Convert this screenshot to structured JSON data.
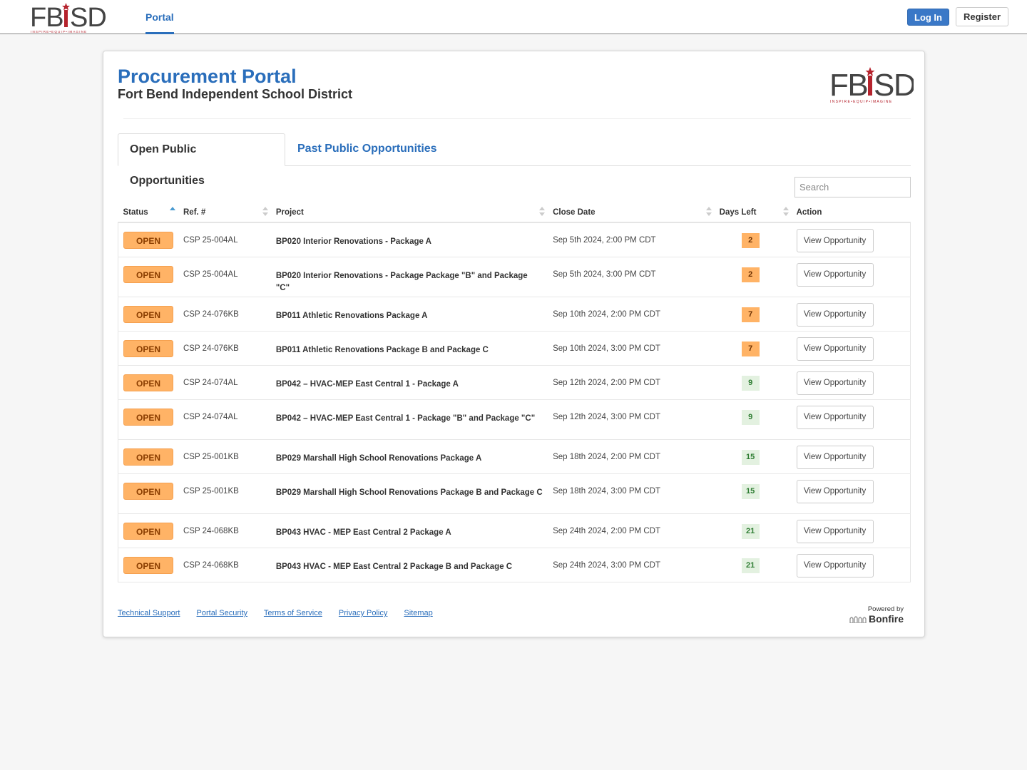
{
  "navbar": {
    "logo_text": "FBISD",
    "logo_tagline": "INSPIRE • EQUIP • IMAGINE",
    "nav_link": "Portal",
    "login_label": "Log In",
    "register_label": "Register",
    "accent_color": "#2a6ebb",
    "logo_accent_color": "#b5232d"
  },
  "header": {
    "title": "Procurement Portal",
    "subtitle": "Fort Bend Independent School District",
    "logo_text": "FBISD",
    "logo_tagline": "INSPIRE • EQUIP • IMAGINE"
  },
  "tabs": [
    {
      "label": "Open Public Opportunities",
      "active": true
    },
    {
      "label": "Past Public Opportunities",
      "active": false
    }
  ],
  "search": {
    "placeholder": "Search",
    "value": ""
  },
  "table": {
    "columns": [
      {
        "label": "Status",
        "sort": "asc"
      },
      {
        "label": "Ref. #",
        "sort": "none"
      },
      {
        "label": "Project",
        "sort": "none"
      },
      {
        "label": "Close Date",
        "sort": "none"
      },
      {
        "label": "Days Left",
        "sort": "none"
      },
      {
        "label": "Action",
        "sort": null
      }
    ],
    "rows": [
      {
        "status": "OPEN",
        "ref": "CSP 25-004AL",
        "project": "BP020 Interior Renovations - Package A",
        "close_date": "Sep 5th 2024, 2:00 PM CDT",
        "days_left": "2",
        "days_level": "warn",
        "action": "View Opportunity"
      },
      {
        "status": "OPEN",
        "ref": "CSP 25-004AL",
        "project": "BP020 Interior Renovations - Package Package \"B\" and Package \"C\"",
        "close_date": "Sep 5th 2024, 3:00 PM CDT",
        "days_left": "2",
        "days_level": "warn",
        "action": "View Opportunity"
      },
      {
        "status": "OPEN",
        "ref": "CSP 24-076KB",
        "project": "BP011 Athletic Renovations Package A",
        "close_date": "Sep 10th 2024, 2:00 PM CDT",
        "days_left": "7",
        "days_level": "warn",
        "action": "View Opportunity"
      },
      {
        "status": "OPEN",
        "ref": "CSP 24-076KB",
        "project": "BP011 Athletic Renovations Package B and Package C",
        "close_date": "Sep 10th 2024, 3:00 PM CDT",
        "days_left": "7",
        "days_level": "warn",
        "action": "View Opportunity"
      },
      {
        "status": "OPEN",
        "ref": "CSP 24-074AL",
        "project": "BP042 – HVAC-MEP East Central 1 - Package A",
        "close_date": "Sep 12th 2024, 2:00 PM CDT",
        "days_left": "9",
        "days_level": "ok",
        "action": "View Opportunity"
      },
      {
        "status": "OPEN",
        "ref": "CSP 24-074AL",
        "project": "BP042 – HVAC-MEP East Central 1 - Package \"B\" and Package \"C\"",
        "close_date": "Sep 12th 2024, 3:00 PM CDT",
        "days_left": "9",
        "days_level": "ok",
        "action": "View Opportunity"
      },
      {
        "status": "OPEN",
        "ref": "CSP 25-001KB",
        "project": "BP029 Marshall High School Renovations Package A",
        "close_date": "Sep 18th 2024, 2:00 PM CDT",
        "days_left": "15",
        "days_level": "ok",
        "action": "View Opportunity"
      },
      {
        "status": "OPEN",
        "ref": "CSP 25-001KB",
        "project": "BP029 Marshall High School Renovations Package B and Package C",
        "close_date": "Sep 18th 2024, 3:00 PM CDT",
        "days_left": "15",
        "days_level": "ok",
        "action": "View Opportunity"
      },
      {
        "status": "OPEN",
        "ref": "CSP 24-068KB",
        "project": "BP043 HVAC - MEP East Central 2 Package A",
        "close_date": "Sep 24th 2024, 2:00 PM CDT",
        "days_left": "21",
        "days_level": "ok",
        "action": "View Opportunity"
      },
      {
        "status": "OPEN",
        "ref": "CSP 24-068KB",
        "project": "BP043 HVAC - MEP East Central 2 Package B and Package C",
        "close_date": "Sep 24th 2024, 3:00 PM CDT",
        "days_left": "21",
        "days_level": "ok",
        "action": "View Opportunity"
      }
    ]
  },
  "footer": {
    "links": [
      "Technical Support",
      "Portal Security",
      "Terms of Service",
      "Privacy Policy",
      "Sitemap"
    ],
    "powered_by": "Powered by",
    "brand": "Bonfire"
  }
}
